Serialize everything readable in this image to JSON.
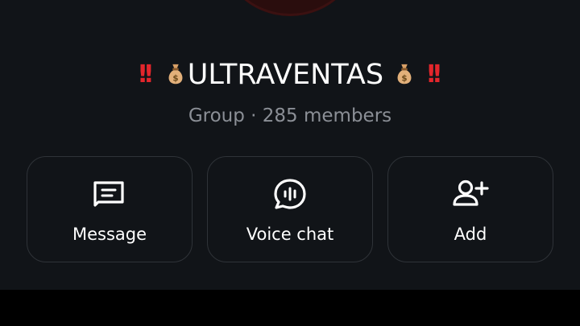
{
  "group": {
    "name": "ULTRAVENTAS",
    "subtitle": "Group · 285 members"
  },
  "icons": {
    "title_decor_left": [
      "double-exclamation-icon",
      "money-bag-icon"
    ],
    "title_decor_right": [
      "money-bag-icon",
      "double-exclamation-icon"
    ]
  },
  "actions": [
    {
      "label": "Message",
      "icon": "message-icon"
    },
    {
      "label": "Voice chat",
      "icon": "voice-chat-icon"
    },
    {
      "label": "Add",
      "icon": "add-member-icon"
    }
  ],
  "colors": {
    "background": "#111418",
    "text": "#ffffff",
    "muted_text": "#8b8f96",
    "border": "#2f3338",
    "exclamation": "#e3262c"
  }
}
